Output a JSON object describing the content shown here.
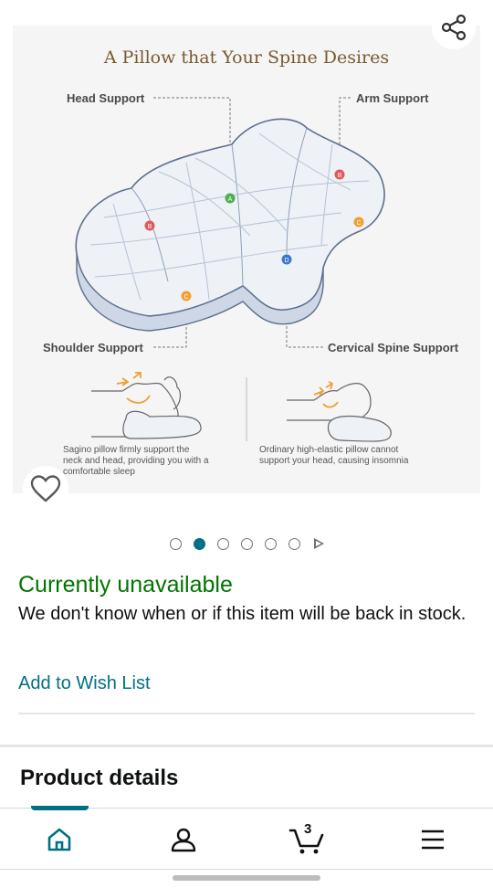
{
  "infographic": {
    "title": "A Pillow that Your Spine Desires",
    "labels": {
      "head_support": "Head Support",
      "arm_support": "Arm Support",
      "shoulder_support": "Shoulder Support",
      "cervical_support": "Cervical Spine Support"
    },
    "markers": [
      "A",
      "B",
      "B",
      "C",
      "C",
      "D"
    ],
    "caption_left": [
      "Sagino pillow firmly support the",
      "neck and head, providing you with a",
      "comfortable sleep"
    ],
    "caption_right": [
      "Ordinary high-elastic pillow cannot",
      "support your head, causing insomnia"
    ]
  },
  "icons": {
    "share": "share-icon",
    "wishlist": "heart-icon",
    "next_image": "play-icon"
  },
  "carousel": {
    "total_dots": 6,
    "active_index": 1
  },
  "availability": {
    "status": "Currently unavailable",
    "message": "We don't know when or if this item will be back in stock.",
    "status_color": "#007600"
  },
  "actions": {
    "wishlist_link": "Add to Wish List"
  },
  "section": {
    "title": "Product details"
  },
  "bottom_nav": {
    "items": [
      "home-icon",
      "account-icon",
      "cart-icon",
      "menu-icon"
    ],
    "cart_count": "3",
    "active": "home"
  },
  "colors": {
    "accent": "#007185",
    "available": "#007600"
  }
}
